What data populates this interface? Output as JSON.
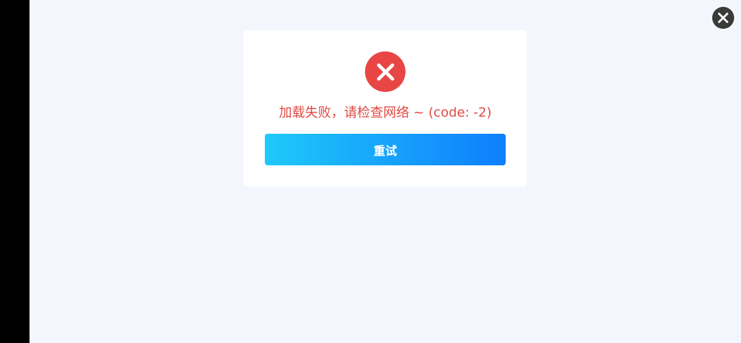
{
  "error": {
    "message": "加载失败，请检查网络 ~ (code: -2)",
    "icon": "error-x-icon",
    "color": "#e84545"
  },
  "retry_button": {
    "label": "重试",
    "gradient_start": "#1ec9fb",
    "gradient_end": "#0f7efc"
  },
  "close_button": {
    "icon": "close-icon"
  }
}
